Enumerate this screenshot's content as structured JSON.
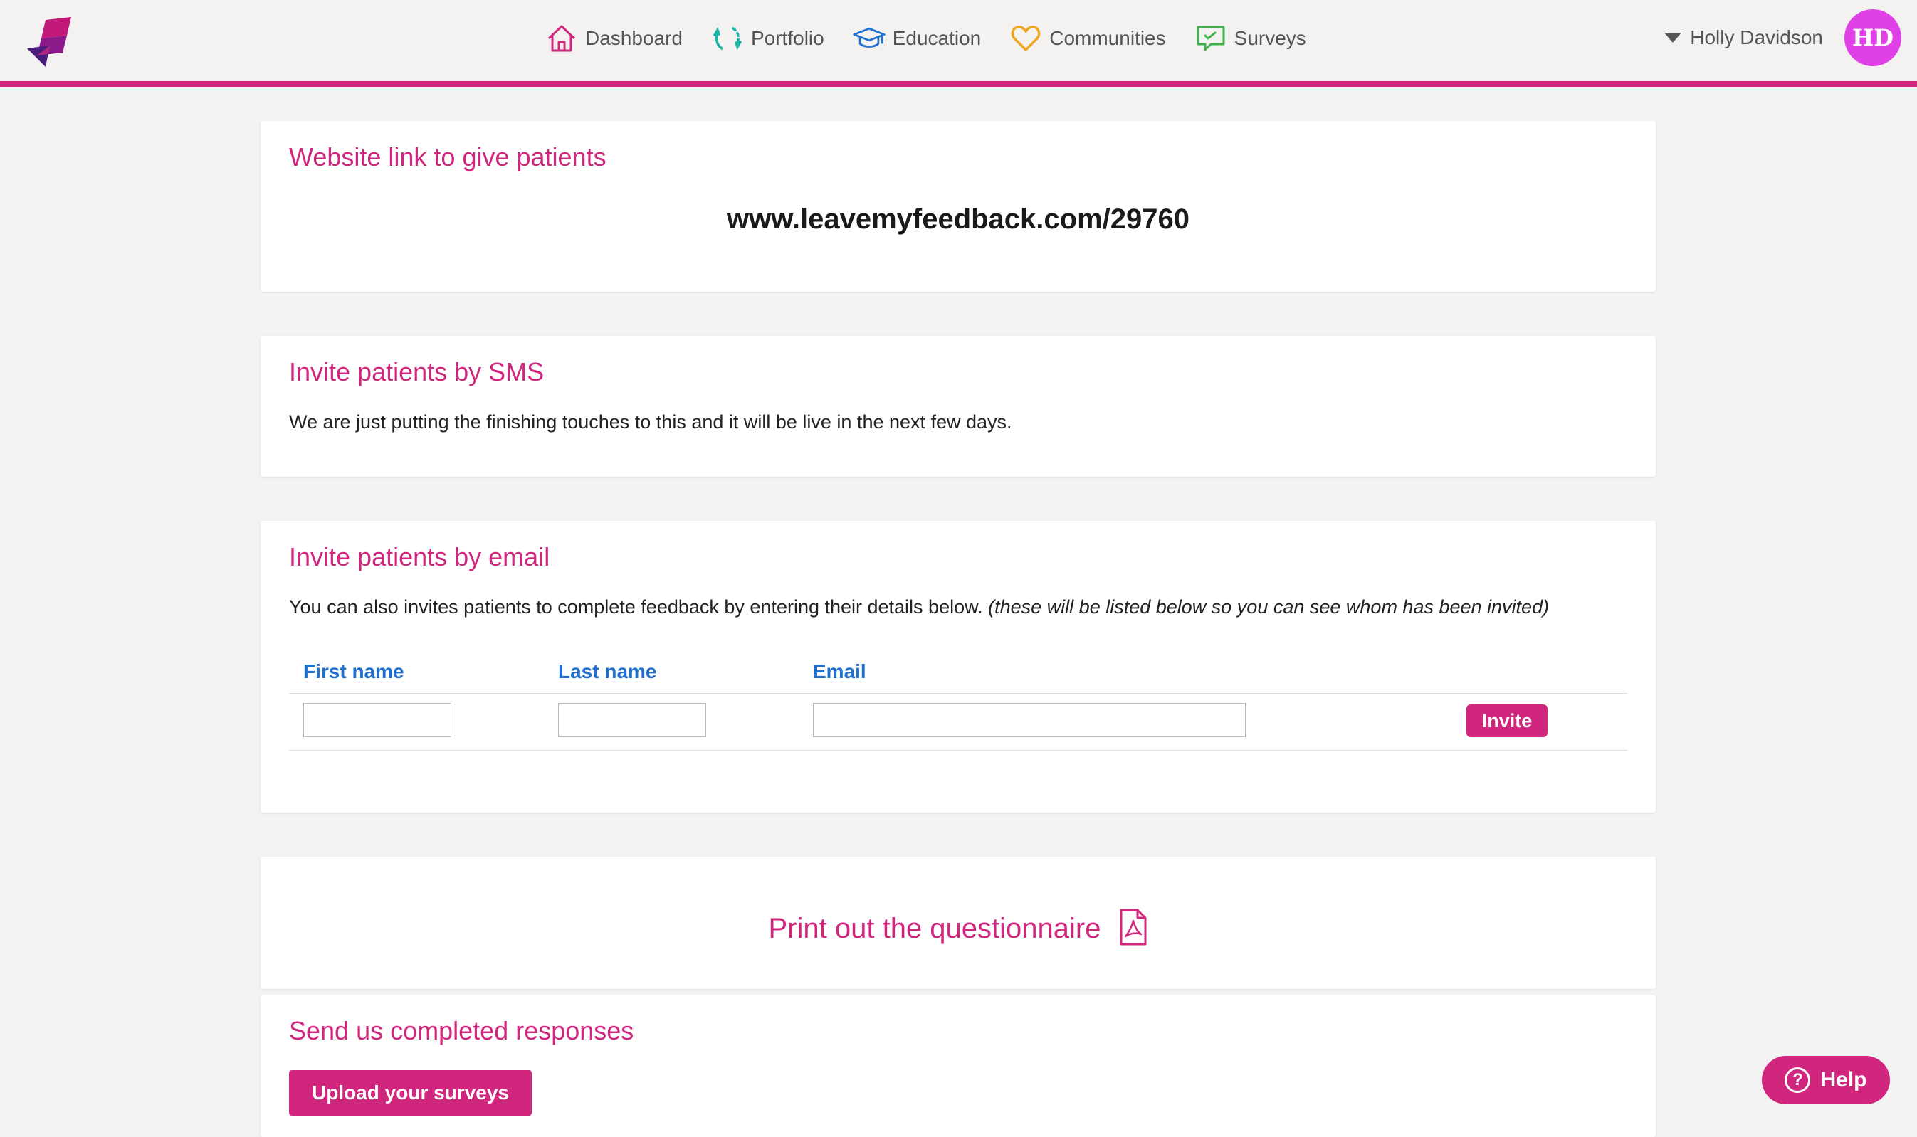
{
  "header": {
    "nav": [
      {
        "label": "Dashboard",
        "icon": "home-icon"
      },
      {
        "label": "Portfolio",
        "icon": "refresh-icon"
      },
      {
        "label": "Education",
        "icon": "graduation-cap-icon"
      },
      {
        "label": "Communities",
        "icon": "heart-icon"
      },
      {
        "label": "Surveys",
        "icon": "chat-icon"
      }
    ],
    "user": {
      "name": "Holly Davidson",
      "initials": "HD"
    }
  },
  "link_card": {
    "title": "Website link to give patients",
    "url": "www.leavemyfeedback.com/29760"
  },
  "sms_card": {
    "title": "Invite patients by SMS",
    "text": "We are just putting the finishing touches to this and it will be live in the next few days."
  },
  "email_card": {
    "title": "Invite patients by email",
    "text": "You can also invites patients to complete feedback by entering their details below.",
    "note": "(these will be listed below so you can see whom has been invited)",
    "columns": {
      "first": "First name",
      "last": "Last name",
      "email": "Email"
    },
    "fields": {
      "first_value": "",
      "last_value": "",
      "email_value": ""
    },
    "invite_label": "Invite"
  },
  "print_card": {
    "label": "Print out the questionnaire"
  },
  "send_card": {
    "title": "Send us completed responses",
    "upload_label": "Upload your surveys"
  },
  "help": {
    "label": "Help",
    "glyph": "?"
  },
  "colors": {
    "brand": "#d1267d",
    "link_blue": "#1f6fd1",
    "avatar": "#e041e6"
  }
}
